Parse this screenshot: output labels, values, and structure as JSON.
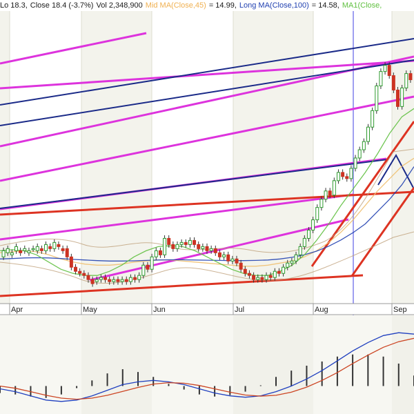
{
  "header": {
    "lo": "Lo 18.3,",
    "close": "Close 18.4 (-3.7%)",
    "vol": "Vol 2,348,900",
    "mid_ma": "Mid MA(Close,45)",
    "mid_ma_val": "= 14.99,",
    "long_ma": "Long MA(Close,100)",
    "long_ma_val": "= 14.58,",
    "ma1": "MA1(Close,"
  },
  "colors": {
    "mid_ma": "#f0c070",
    "long_ma": "#2040b0",
    "ma1": "#60c040",
    "magenta_lines": "#dd33dd",
    "navy_lines": "#1a2a88",
    "red_lines": "#dd3322",
    "cursor": "#8888ee",
    "up_candle": "#2e9a2e",
    "down_candle": "#cc3322",
    "macd_line": "#1f3fbf",
    "signal_line": "#cc4422"
  },
  "chart_data": {
    "type": "candlestick",
    "x_labels": [
      "Apr",
      "May",
      "Jun",
      "Jul",
      "Aug",
      "Sep"
    ],
    "candles": [
      [
        10.2,
        10.5
      ],
      [
        10.4,
        10.6
      ],
      [
        10.3,
        10.4
      ],
      [
        10.5,
        10.7
      ],
      [
        10.5,
        10.4
      ],
      [
        10.5,
        10.6
      ],
      [
        10.4,
        10.5
      ],
      [
        10.6,
        10.6
      ],
      [
        10.5,
        10.7
      ],
      [
        10.6,
        10.5
      ],
      [
        10.5,
        10.8
      ],
      [
        10.7,
        10.6
      ],
      [
        10.6,
        10.9
      ],
      [
        10.8,
        10.7
      ],
      [
        10.6,
        10.5
      ],
      [
        10.6,
        10.2
      ],
      [
        10.2,
        9.7
      ],
      [
        9.7,
        9.5
      ],
      [
        9.5,
        9.4
      ],
      [
        9.4,
        9.3
      ],
      [
        9.3,
        9.1
      ],
      [
        9.1,
        8.9
      ],
      [
        9.0,
        9.1
      ],
      [
        9.1,
        9.2
      ],
      [
        9.2,
        9.1
      ],
      [
        9.1,
        9.0
      ],
      [
        9.0,
        9.1
      ],
      [
        9.1,
        9.0
      ],
      [
        9.0,
        9.1
      ],
      [
        9.1,
        9.0
      ],
      [
        9.0,
        9.2
      ],
      [
        9.2,
        9.1
      ],
      [
        9.1,
        9.3
      ],
      [
        9.3,
        9.8
      ],
      [
        9.8,
        9.6
      ],
      [
        9.6,
        10.2
      ],
      [
        10.2,
        10.5
      ],
      [
        10.5,
        10.3
      ],
      [
        10.3,
        11.1
      ],
      [
        11.1,
        10.8
      ],
      [
        10.8,
        10.6
      ],
      [
        10.6,
        10.8
      ],
      [
        10.8,
        10.9
      ],
      [
        10.9,
        10.8
      ],
      [
        10.8,
        11.0
      ],
      [
        11.0,
        10.8
      ],
      [
        10.8,
        10.6
      ],
      [
        10.6,
        10.7
      ],
      [
        10.7,
        10.5
      ],
      [
        10.5,
        10.6
      ],
      [
        10.6,
        10.4
      ],
      [
        10.4,
        10.2
      ],
      [
        10.2,
        10.3
      ],
      [
        10.3,
        10.0
      ],
      [
        10.0,
        10.1
      ],
      [
        10.1,
        9.9
      ],
      [
        9.9,
        9.6
      ],
      [
        9.6,
        9.4
      ],
      [
        9.4,
        9.3
      ],
      [
        9.3,
        9.1
      ],
      [
        9.1,
        9.2
      ],
      [
        9.2,
        9.1
      ],
      [
        9.1,
        9.3
      ],
      [
        9.3,
        9.2
      ],
      [
        9.2,
        9.5
      ],
      [
        9.5,
        9.4
      ],
      [
        9.4,
        9.7
      ],
      [
        9.7,
        9.9
      ],
      [
        9.9,
        10.0
      ],
      [
        10.0,
        10.3
      ],
      [
        10.3,
        10.7
      ],
      [
        10.7,
        11.1
      ],
      [
        11.1,
        11.5
      ],
      [
        11.5,
        12.0
      ],
      [
        12.0,
        12.6
      ],
      [
        12.6,
        13.0
      ],
      [
        13.0,
        13.4
      ],
      [
        13.4,
        13.2
      ],
      [
        13.2,
        13.9
      ],
      [
        13.9,
        14.3
      ],
      [
        14.3,
        14.1
      ],
      [
        14.1,
        14.0
      ],
      [
        14.0,
        14.5
      ],
      [
        14.5,
        15.0
      ],
      [
        15.0,
        15.4
      ],
      [
        15.4,
        15.8
      ],
      [
        15.8,
        16.5
      ],
      [
        16.5,
        17.3
      ],
      [
        17.3,
        18.5
      ],
      [
        18.5,
        19.2
      ],
      [
        19.2,
        19.5
      ],
      [
        19.5,
        19.0
      ],
      [
        19.0,
        18.3
      ],
      [
        18.3,
        17.5
      ],
      [
        17.5,
        18.4
      ],
      [
        18.4,
        19.1
      ],
      [
        19.1,
        18.8
      ]
    ],
    "moving_averages": [
      {
        "name": "Mid MA(Close,45)",
        "values": [
          10.4,
          10.45,
          10.5,
          10.45,
          10.3,
          10.1,
          9.95,
          9.85,
          9.8,
          9.8,
          9.85,
          9.95,
          10.0,
          10.05,
          10.05,
          10.0,
          9.95,
          9.9,
          9.85,
          9.8,
          9.75,
          9.75,
          9.8,
          9.9,
          10.0,
          10.2,
          10.5,
          10.9,
          11.4,
          12.0,
          12.7,
          13.4,
          14.0,
          14.6,
          14.99
        ]
      },
      {
        "name": "Long MA(Close,100)",
        "values": [
          10.1,
          10.12,
          10.15,
          10.16,
          10.15,
          10.12,
          10.08,
          10.05,
          10.02,
          10.0,
          10.0,
          10.01,
          10.03,
          10.05,
          10.06,
          10.06,
          10.05,
          10.04,
          10.03,
          10.02,
          10.02,
          10.03,
          10.05,
          10.1,
          10.18,
          10.3,
          10.48,
          10.72,
          11.02,
          11.38,
          11.8,
          12.4,
          13.0,
          13.7,
          14.58
        ]
      },
      {
        "name": "MA1",
        "values": [
          10.5,
          10.55,
          10.5,
          10.3,
          9.95,
          9.6,
          9.4,
          9.3,
          9.3,
          9.5,
          9.8,
          10.2,
          10.5,
          10.7,
          10.75,
          10.7,
          10.5,
          10.2,
          9.9,
          9.6,
          9.4,
          9.3,
          9.3,
          9.5,
          9.8,
          10.3,
          11.0,
          11.8,
          12.7,
          13.5,
          14.3,
          15.2,
          16.2,
          17.0,
          17.4
        ]
      }
    ],
    "macd": [
      {
        "name": "macd",
        "values": [
          -0.1,
          -0.2,
          -0.35,
          -0.5,
          -0.55,
          -0.5,
          -0.35,
          -0.15,
          0.05,
          0.15,
          0.2,
          0.15,
          0.05,
          -0.1,
          -0.25,
          -0.35,
          -0.4,
          -0.35,
          -0.2,
          0.0,
          0.25,
          0.55,
          0.9,
          1.25,
          1.55,
          1.8,
          1.9,
          1.85
        ]
      },
      {
        "name": "signal",
        "values": [
          0.0,
          -0.08,
          -0.2,
          -0.33,
          -0.43,
          -0.47,
          -0.43,
          -0.33,
          -0.19,
          -0.05,
          0.07,
          0.12,
          0.1,
          0.02,
          -0.1,
          -0.22,
          -0.32,
          -0.36,
          -0.33,
          -0.22,
          -0.04,
          0.2,
          0.48,
          0.8,
          1.1,
          1.38,
          1.58,
          1.7
        ]
      }
    ],
    "ylim": [
      8.0,
      22.0
    ]
  }
}
